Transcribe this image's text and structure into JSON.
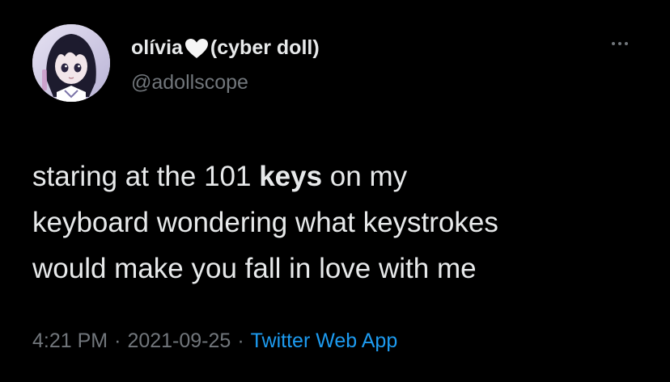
{
  "author": {
    "name_before": "olívia",
    "heart_emoji": "🤍",
    "name_after": "(cyber doll)",
    "handle": "@adollscope"
  },
  "more_icon": "more-horizontal-icon",
  "tweet": {
    "line1_pre": "staring at the 101 ",
    "line1_bold": "keys",
    "line1_post": " on my",
    "line2": "keyboard wondering what keystrokes",
    "line3": "would make you fall in love with me"
  },
  "meta": {
    "time": "4:21 PM",
    "separator": "·",
    "date": "2021-09-25",
    "source": "Twitter Web App"
  },
  "colors": {
    "background": "#000000",
    "text": "#e7e9ea",
    "secondary": "#71767b",
    "link": "#1d9bf0"
  }
}
